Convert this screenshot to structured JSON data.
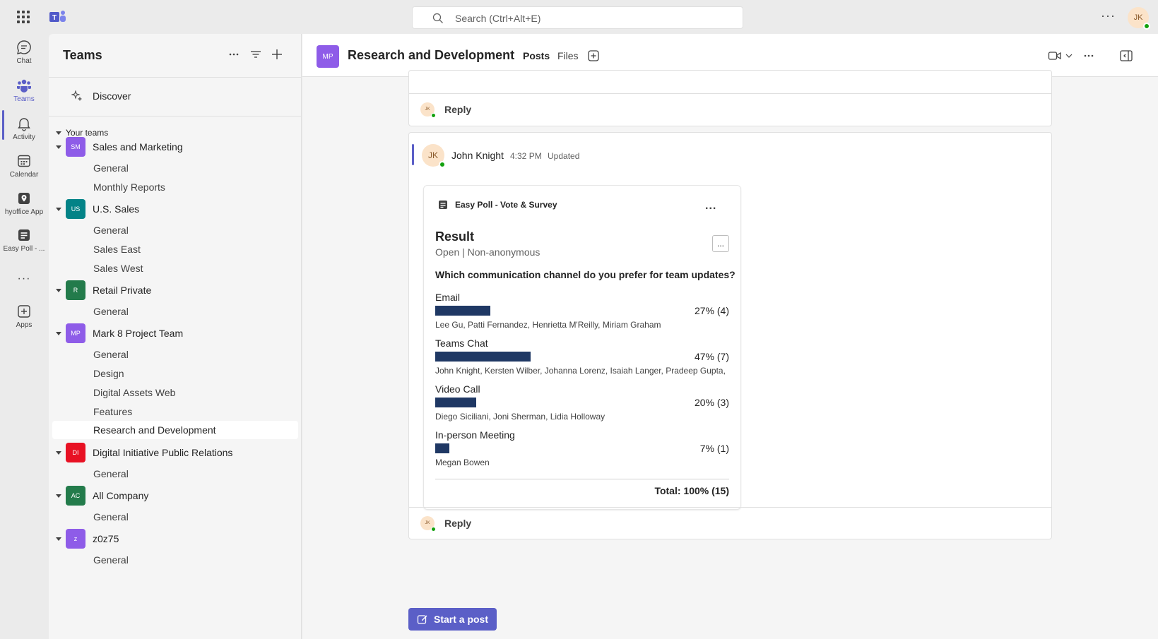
{
  "topbar": {
    "search_placeholder": "Search (Ctrl+Alt+E)",
    "user_initials": "JK"
  },
  "rail": {
    "items": [
      {
        "label": "Chat",
        "icon": "chat-icon"
      },
      {
        "label": "Teams",
        "icon": "teams-icon"
      },
      {
        "label": "Activity",
        "icon": "bell-icon"
      },
      {
        "label": "Calendar",
        "icon": "calendar-icon"
      },
      {
        "label": "hyoffice App",
        "icon": "location-pin-icon"
      },
      {
        "label": "Easy Poll - ...",
        "icon": "poll-icon"
      },
      {
        "label": "Apps",
        "icon": "add-apps-icon"
      }
    ]
  },
  "panel": {
    "title": "Teams",
    "discover": "Discover",
    "your_teams": "Your teams",
    "teams": [
      {
        "name": "Sales and Marketing",
        "initials": "SM",
        "color": "#8e5ce8",
        "channels": [
          "General",
          "Monthly Reports"
        ]
      },
      {
        "name": "U.S. Sales",
        "initials": "US",
        "color": "#038387",
        "channels": [
          "General",
          "Sales East",
          "Sales West"
        ]
      },
      {
        "name": "Retail Private",
        "initials": "R",
        "color": "#237b4b",
        "channels": [
          "General"
        ]
      },
      {
        "name": "Mark 8 Project Team",
        "initials": "MP",
        "color": "#8e5ce8",
        "channels": [
          "General",
          "Design",
          "Digital Assets Web",
          "Features",
          "Research and Development"
        ]
      },
      {
        "name": "Digital Initiative Public Relations",
        "initials": "DI",
        "color": "#e81123",
        "channels": [
          "General"
        ]
      },
      {
        "name": "All Company",
        "initials": "AC",
        "color": "#237b4b",
        "channels": [
          "General"
        ]
      },
      {
        "name": "z0z75",
        "initials": "z",
        "color": "#8e5ce8",
        "channels": [
          "General"
        ]
      }
    ]
  },
  "main": {
    "badge": "MP",
    "title": "Research and Development",
    "tabs": [
      "Posts",
      "Files"
    ],
    "reply_label": "Reply",
    "reply_avatar": "JK",
    "message": {
      "avatar": "JK",
      "author": "John Knight",
      "time": "4:32 PM",
      "updated": "Updated"
    },
    "poll": {
      "app_name": "Easy Poll - Vote & Survey",
      "more": "...",
      "result_title": "Result",
      "status": "Open | Non-anonymous",
      "ellipsis_button": "...",
      "question": "Which communication channel do you prefer for team updates?",
      "options": [
        {
          "label": "Email",
          "percent_text": "27% (4)",
          "fraction": 0.27,
          "voters": "Lee Gu, Patti Fernandez, Henrietta M'Reilly, Miriam Graham"
        },
        {
          "label": "Teams Chat",
          "percent_text": "47% (7)",
          "fraction": 0.47,
          "voters": "John Knight, Kersten Wilber, Johanna Lorenz, Isaiah Langer, Pradeep Gupta, ..."
        },
        {
          "label": "Video Call",
          "percent_text": "20% (3)",
          "fraction": 0.2,
          "voters": "Diego Siciliani, Joni Sherman, Lidia Holloway"
        },
        {
          "label": "In-person Meeting",
          "percent_text": "7% (1)",
          "fraction": 0.07,
          "voters": "Megan Bowen"
        }
      ],
      "total": "Total: 100% (15)"
    },
    "start_post": "Start a post"
  },
  "colors": {
    "accent": "#5b5fc7",
    "poll_bar": "#1f3864",
    "presence": "#13a10e"
  }
}
